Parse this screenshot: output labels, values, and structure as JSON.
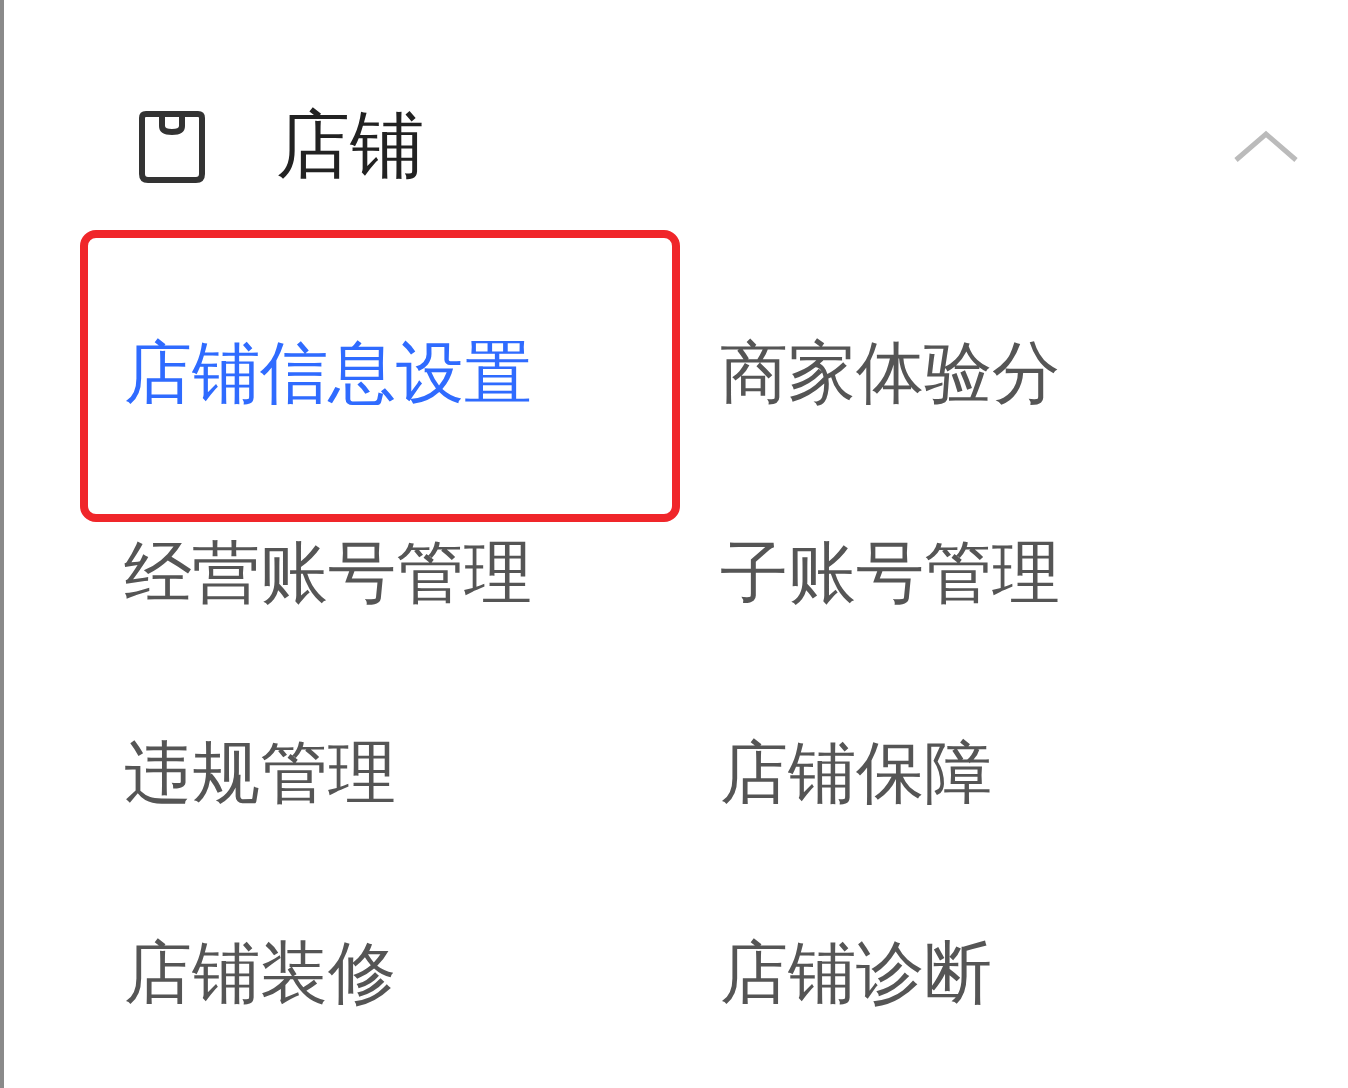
{
  "section": {
    "title": "店铺",
    "expanded": true
  },
  "items": [
    {
      "label": "店铺信息设置",
      "selected": true
    },
    {
      "label": "商家体验分",
      "selected": false
    },
    {
      "label": "经营账号管理",
      "selected": false
    },
    {
      "label": "子账号管理",
      "selected": false
    },
    {
      "label": "违规管理",
      "selected": false
    },
    {
      "label": "店铺保障",
      "selected": false
    },
    {
      "label": "店铺装修",
      "selected": false
    },
    {
      "label": "店铺诊断",
      "selected": false
    }
  ]
}
